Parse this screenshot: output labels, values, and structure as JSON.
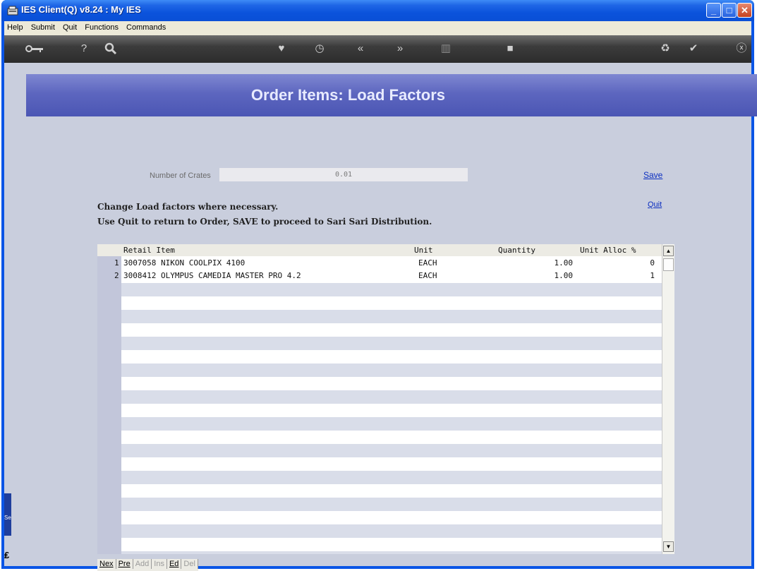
{
  "window": {
    "title": "IES Client(Q) v8.24 : My IES"
  },
  "menu": [
    "Help",
    "Submit",
    "Quit",
    "Functions",
    "Commands"
  ],
  "toolbar": {
    "icons": [
      "key-icon",
      "help-icon",
      "search-icon",
      "heart-icon",
      "clock-icon",
      "rewind-icon",
      "forward-icon",
      "trash-icon",
      "window-icon",
      "recycle-icon",
      "check-icon",
      "close-icon"
    ]
  },
  "page": {
    "title": "Order Items: Load Factors",
    "crates_label": "Number of Crates",
    "crates_value": "0.01",
    "save_label": "Save",
    "quit_label": "Quit",
    "instruction_1": "Change Load factors where necessary.",
    "instruction_2": "Use Quit to return to Order, SAVE to proceed to Sari Sari Distribution."
  },
  "table": {
    "columns": [
      "Retail Item",
      "Unit",
      "Quantity",
      "Unit Alloc %"
    ],
    "rows": [
      {
        "num": "1",
        "item": "3007058 NIKON COOLPIX 4100",
        "unit": "EACH",
        "qty": "1.00",
        "alloc": "0"
      },
      {
        "num": "2",
        "item": "3008412 OLYMPUS CAMEDIA MASTER PRO 4.2",
        "unit": "EACH",
        "qty": "1.00",
        "alloc": "1"
      }
    ]
  },
  "nav": {
    "next": "Nex",
    "prev": "Pre",
    "add": "Add",
    "ins": "Ins",
    "ed": "Ed",
    "del": "Del"
  },
  "sidebar": {
    "tab_label": "Ses"
  }
}
